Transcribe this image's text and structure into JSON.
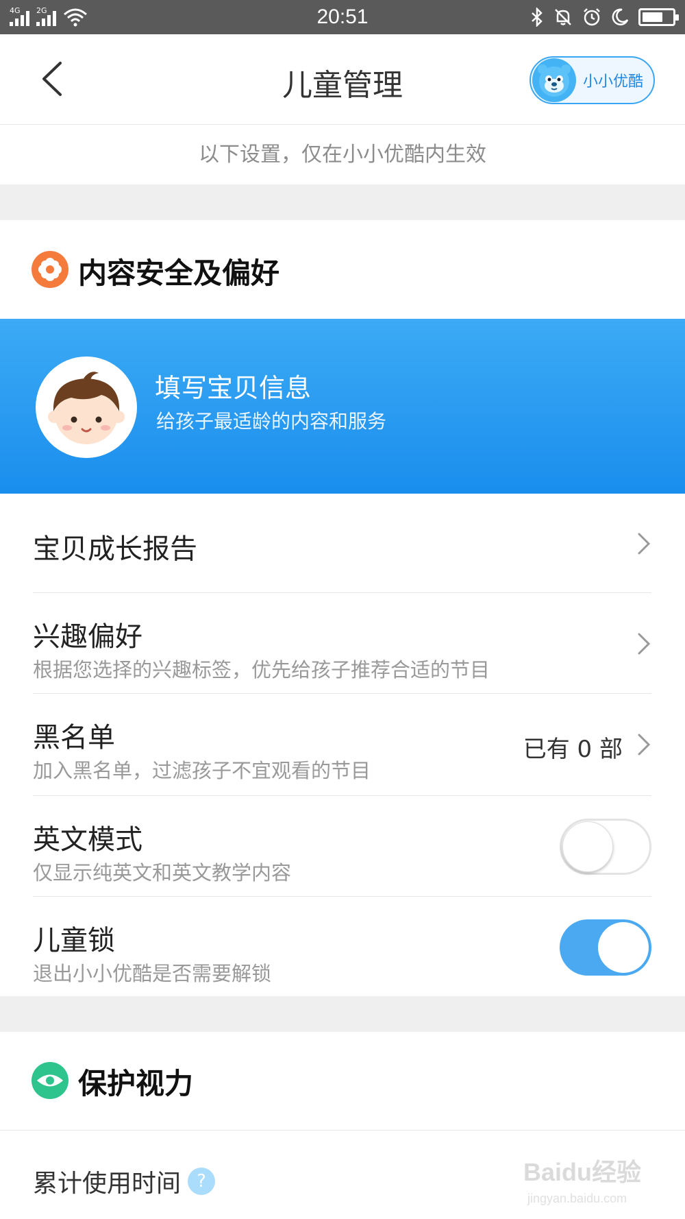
{
  "status_bar": {
    "sim1_tag": "4G",
    "sim2_tag": "2G",
    "time": "20:51",
    "battery_level_percent": 70,
    "icons": [
      "signal-icon",
      "signal-icon",
      "wifi-icon",
      "bluetooth-icon",
      "mute-icon",
      "alarm-icon",
      "moon-icon",
      "battery-icon"
    ]
  },
  "header": {
    "title": "儿童管理",
    "back_icon": "chevron-left-icon",
    "brand_label": "小小优酷",
    "brand_avatar_icon": "mascot-icon"
  },
  "notice": "以下设置，仅在小小优酷内生效",
  "section_content": {
    "title": "内容安全及偏好",
    "icon": "flower-icon",
    "color": "#f47b3c"
  },
  "banner": {
    "title": "填写宝贝信息",
    "subtitle": "给孩子最适龄的内容和服务",
    "avatar_icon": "baby-face-icon"
  },
  "rows": {
    "growth_report": {
      "title": "宝贝成长报告"
    },
    "interests": {
      "title": "兴趣偏好",
      "subtitle": "根据您选择的兴趣标签，优先给孩子推荐合适的节目"
    },
    "blacklist": {
      "title": "黑名单",
      "subtitle": "加入黑名单，过滤孩子不宜观看的节目",
      "value_prefix": "已有",
      "count": "0",
      "value_suffix": "部"
    },
    "english_mode": {
      "title": "英文模式",
      "subtitle": "仅显示纯英文和英文教学内容",
      "enabled": false
    },
    "child_lock": {
      "title": "儿童锁",
      "subtitle": "退出小小优酷是否需要解锁",
      "enabled": true
    }
  },
  "section_eyes": {
    "title": "保护视力",
    "icon": "eye-icon",
    "color": "#2fc48d"
  },
  "usage": {
    "label": "累计使用时间",
    "help": "?"
  },
  "watermark": {
    "text": "Baidu经验",
    "url_text": "jingyan.baidu.com"
  },
  "colors": {
    "accent": "#1a8eed",
    "toggle_on": "#4aa9f0"
  }
}
